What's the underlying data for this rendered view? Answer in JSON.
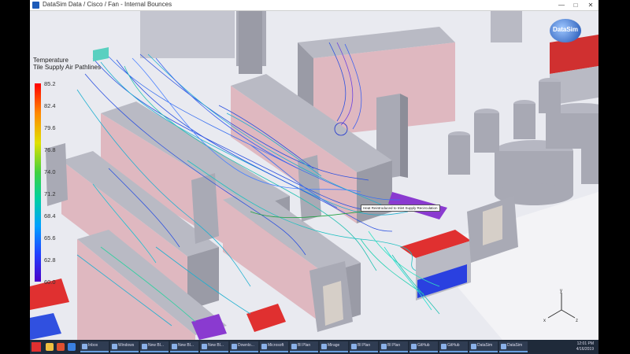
{
  "window": {
    "title": "DataSim Data / Cisco / Fan - Internal Bounces",
    "minimize": "—",
    "maximize": "□",
    "close": "✕"
  },
  "legend": {
    "title": "Temperature",
    "subtitle": "Tile Supply Air Pathlines",
    "ticks": [
      "85.2",
      "82.4",
      "79.6",
      "76.8",
      "74.0",
      "71.2",
      "68.4",
      "65.6",
      "62.8",
      "60.0"
    ]
  },
  "logo": {
    "text": "DataSim"
  },
  "callout": {
    "text": "Heat Reintroduced to Inlet Supply Recirculation"
  },
  "axes": {
    "x": "x",
    "y": "y",
    "z": "z"
  },
  "taskbar": {
    "items": [
      "Inbox",
      "Windows",
      "New Bl...",
      "New Bl...",
      "New Bl...",
      "Downlo...",
      "Microsoft",
      "BI Plan",
      "Mirage",
      "BI Plan",
      "BI Plan",
      "GitHub",
      "GitHub",
      "DataSim",
      "DataSim"
    ],
    "clock_time": "12:01 PM",
    "clock_date": "4/16/2019"
  },
  "colors": {
    "floor": "#e9eaf0",
    "rack_top": "#b9bac4",
    "rack_front": "#dfb8c0",
    "rack_side": "#9a9ba6",
    "pathline_blue": "#2a50e0",
    "pathline_cyan": "#20b0d0",
    "hot_red": "#e03030",
    "purple": "#8a3ad0"
  }
}
